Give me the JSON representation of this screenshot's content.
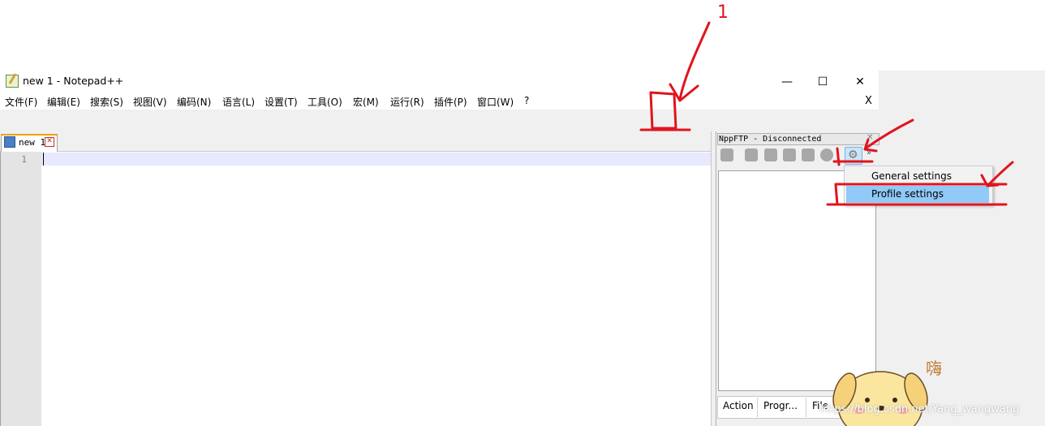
{
  "window": {
    "title": "new 1 - Notepad++",
    "controls": [
      "—",
      "☐",
      "✕"
    ]
  },
  "menu": {
    "items": [
      "文件(F)",
      "编辑(E)",
      "搜索(S)",
      "视图(V)",
      "编码(N)",
      "语言(L)",
      "设置(T)",
      "工具(O)",
      "宏(M)",
      "运行(R)",
      "插件(P)",
      "窗口(W)",
      "?"
    ],
    "close": "X"
  },
  "tab": {
    "label": "new 1",
    "close": "✕"
  },
  "editor": {
    "line_number": "1"
  },
  "ftp": {
    "title": "NppFTP - Disconnected",
    "close": "✕",
    "more": "»",
    "queue_columns": [
      "Action",
      "Progr...",
      "File"
    ]
  },
  "context_menu": {
    "items": [
      "General settings",
      "Profile settings"
    ],
    "highlighted": "Profile settings"
  },
  "watermark": "https://blog.csdn.net/Yang_wangwang",
  "annotations": {
    "numeral": "1",
    "char": "嗨"
  },
  "colors": {
    "annotation_red": "#e0141e",
    "highlight_blue": "#91c9f7",
    "tab_accent": "#f0a000"
  }
}
